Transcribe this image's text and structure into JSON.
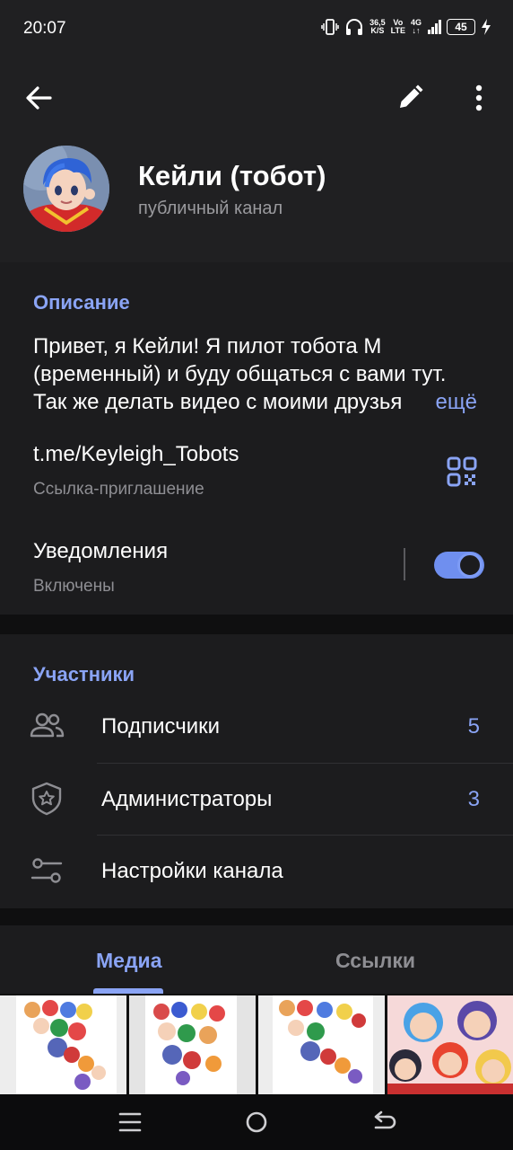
{
  "status_bar": {
    "time": "20:07",
    "net_speed": "36,5",
    "net_speed_unit": "K/S",
    "volte": "Vo",
    "volte_sub": "LTE",
    "network": "4G",
    "battery": "45"
  },
  "header": {
    "channel_name": "Кейли (тобот)",
    "channel_type": "публичный канал"
  },
  "info": {
    "description_label": "Описание",
    "description_text": "Привет, я Кейли! Я пилот тобота М\n(временный) и буду общаться с вами тут.\nТак же делать видео с моими друзья",
    "more_label": "ещё",
    "link": "t.me/Keyleigh_Tobots",
    "link_caption": "Ссылка-приглашение",
    "notifications_label": "Уведомления",
    "notifications_status": "Включены",
    "notifications_on": true
  },
  "members": {
    "section_label": "Участники",
    "rows": [
      {
        "label": "Подписчики",
        "count": "5",
        "icon": "users-icon"
      },
      {
        "label": "Администраторы",
        "count": "3",
        "icon": "admin-shield-icon"
      },
      {
        "label": "Настройки канала",
        "count": "",
        "icon": "sliders-icon"
      }
    ]
  },
  "tabs": {
    "media": "Медиа",
    "links": "Ссылки",
    "active": "media"
  },
  "colors": {
    "accent": "#8aa4f5",
    "background": "#1c1c1e",
    "header_bg": "#202022"
  }
}
